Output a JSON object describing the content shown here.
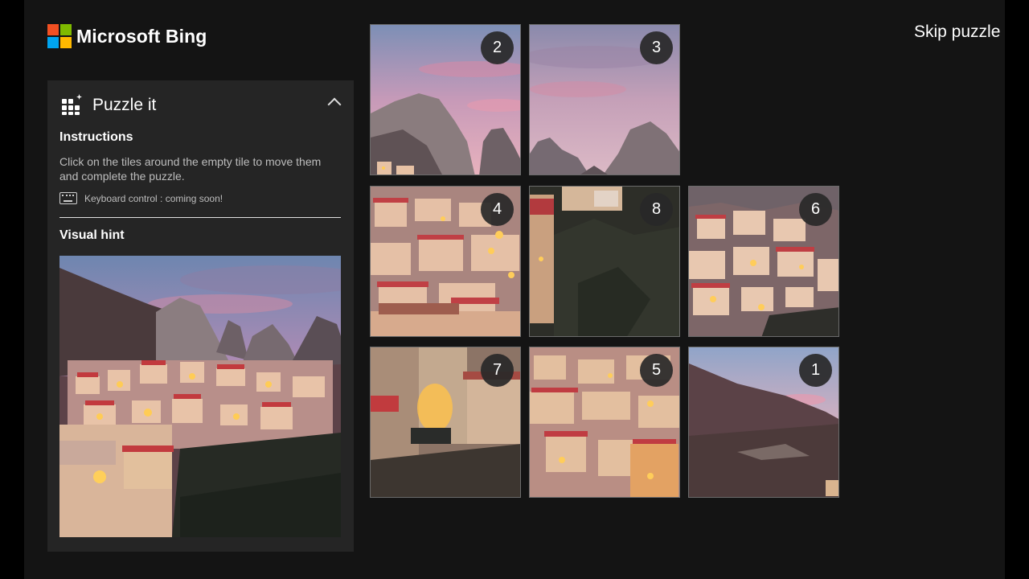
{
  "brand": {
    "name": "Microsoft Bing",
    "logo_colors": [
      "#f25022",
      "#7fba00",
      "#00a4ef",
      "#ffb900"
    ]
  },
  "panel": {
    "title": "Puzzle it",
    "icon": "puzzle-grid-icon",
    "instructions_heading": "Instructions",
    "instructions_text": "Click on the tiles around the empty tile to move them and complete the puzzle.",
    "keyboard_text": "Keyboard control : coming soon!",
    "visual_hint_heading": "Visual hint"
  },
  "skip_label": "Skip puzzle",
  "puzzle": {
    "grid": [
      [
        "2",
        "3",
        ""
      ],
      [
        "4",
        "8",
        "6"
      ],
      [
        "7",
        "5",
        "1"
      ]
    ],
    "empty_position": {
      "row": 0,
      "col": 2
    }
  },
  "colors": {
    "background": "#141414",
    "panel": "#252525",
    "badge": "#282828"
  }
}
